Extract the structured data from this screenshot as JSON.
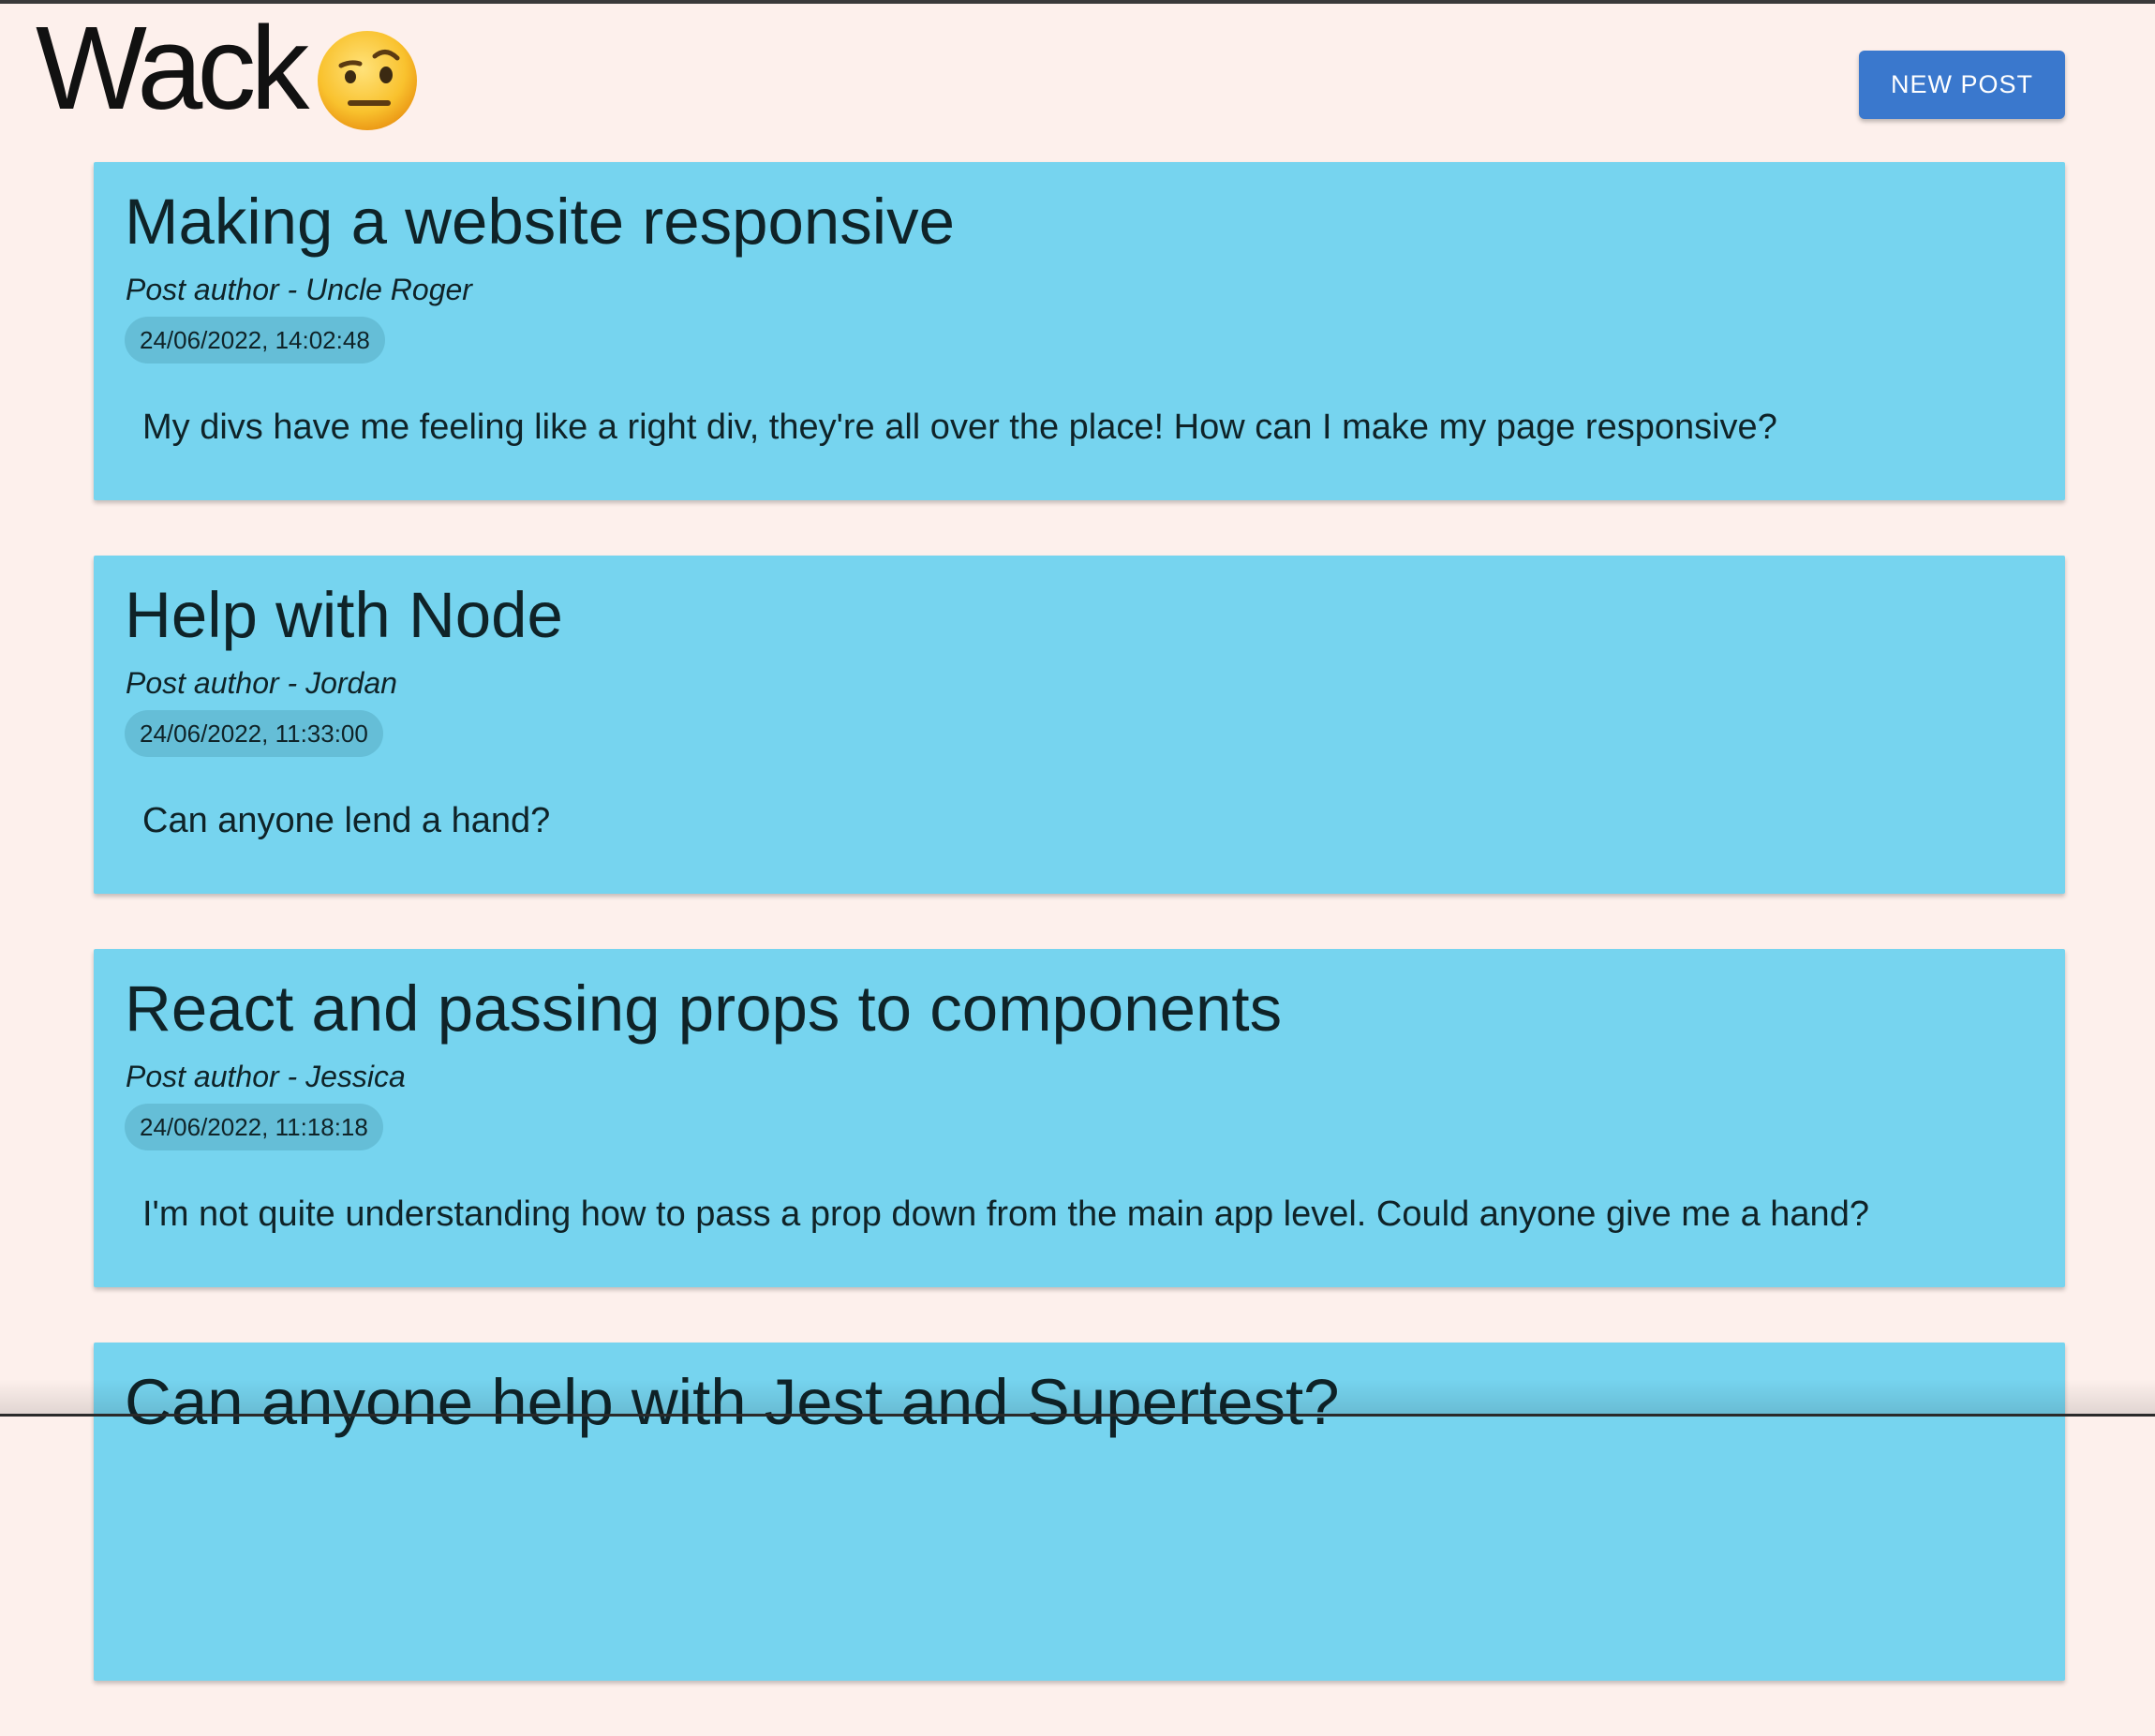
{
  "header": {
    "logo_text": "Wack",
    "logo_emoji": "face-with-raised-eyebrow",
    "new_post_label": "NEW POST"
  },
  "colors": {
    "background": "#fdf0ec",
    "card": "#76d4ef",
    "date_chip": "#65bed7",
    "button": "#3a78cd"
  },
  "posts": [
    {
      "title": "Making a website responsive",
      "author": "Post author - Uncle Roger",
      "date": "24/06/2022, 14:02:48",
      "body": "My divs have me feeling like a right div, they're all over the place! How can I make my page responsive?"
    },
    {
      "title": "Help with Node",
      "author": "Post author - Jordan",
      "date": "24/06/2022, 11:33:00",
      "body": "Can anyone lend a hand?"
    },
    {
      "title": "React and passing props to components",
      "author": "Post author - Jessica",
      "date": "24/06/2022, 11:18:18",
      "body": "I'm not quite understanding how to pass a prop down from the main app level. Could anyone give me a hand?"
    },
    {
      "title": "Can anyone help with Jest and Supertest?"
    }
  ]
}
